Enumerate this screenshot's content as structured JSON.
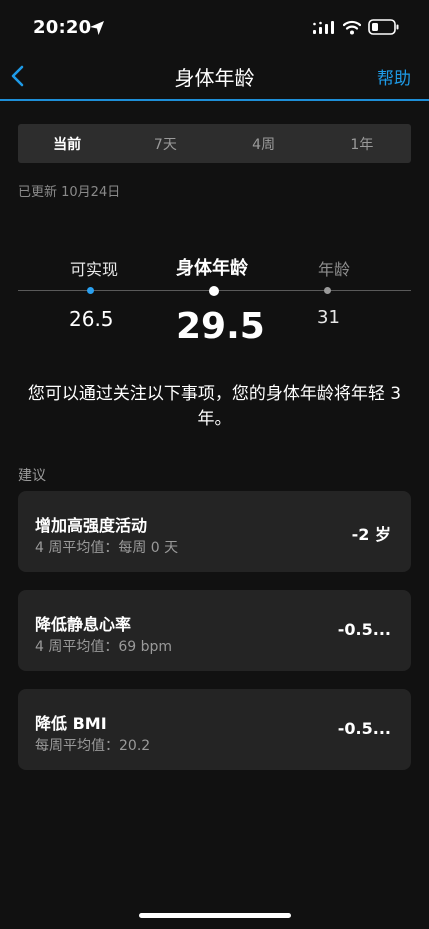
{
  "status_bar": {
    "time": "20:20",
    "icons": [
      "location-arrow-icon",
      "signal-icon",
      "wifi-icon",
      "battery-icon"
    ]
  },
  "nav": {
    "title": "身体年龄",
    "help": "帮助",
    "back_icon": "chevron-left-icon",
    "accent_color": "#1e9be8"
  },
  "tabs": [
    {
      "label": "当前",
      "active": true
    },
    {
      "label": "7天",
      "active": false
    },
    {
      "label": "4周",
      "active": false
    },
    {
      "label": "1年",
      "active": false
    }
  ],
  "updated": "已更新 10月24日",
  "fitness_age": {
    "achievable_label": "可实现",
    "achievable_value": "26.5",
    "fitness_label": "身体年龄",
    "fitness_value": "29.5",
    "age_label": "年龄",
    "age_value": "31",
    "colors": {
      "achievable": "#2aa0f0",
      "fitness": "#ffffff",
      "age": "#9a9a9a"
    }
  },
  "message": "您可以通过关注以下事项，您的身体年龄将年轻 3 年。",
  "suggestions": {
    "title": "建议",
    "items": [
      {
        "title": "增加高强度活动",
        "subtitle": "4 周平均值：每周 0 天",
        "value": "-2 岁"
      },
      {
        "title": "降低静息心率",
        "subtitle": "4 周平均值：69 bpm",
        "value": "-0.5..."
      },
      {
        "title": "降低 BMI",
        "subtitle": "每周平均值：20.2",
        "value": "-0.5..."
      }
    ]
  }
}
